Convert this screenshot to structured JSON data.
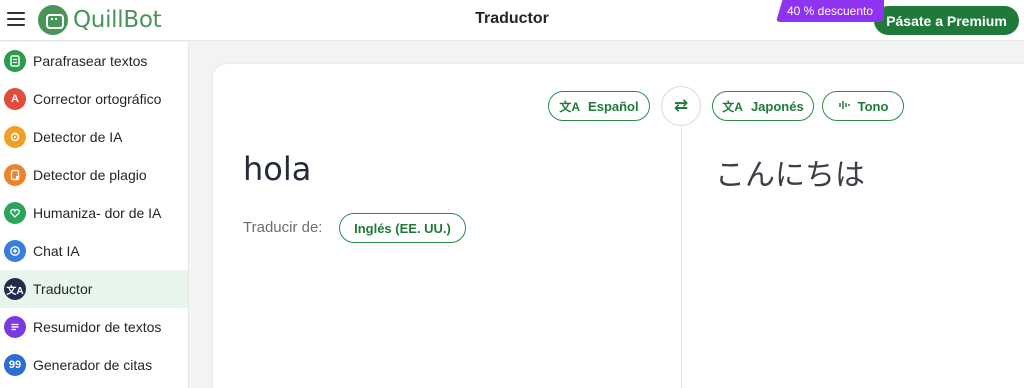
{
  "header": {
    "logo_text": "QuillBot",
    "title": "Traductor",
    "discount_badge": "40 % descuento",
    "premium_label": "Pásate a Premium"
  },
  "sidebar": {
    "items": [
      {
        "label": "Parafrasear textos",
        "icon": "paraphrase-icon",
        "color": "#2a9a4b",
        "glyph": "≡"
      },
      {
        "label": "Corrector ortográfico",
        "icon": "grammar-icon",
        "color": "#e04d3a",
        "glyph": "A"
      },
      {
        "label": "Detector de IA",
        "icon": "ai-detector-icon",
        "color": "#f0a028",
        "glyph": "◎"
      },
      {
        "label": "Detector de plagio",
        "icon": "plagiarism-icon",
        "color": "#f08228",
        "glyph": "▤"
      },
      {
        "label": "Humaniza- dor de IA",
        "icon": "humanizer-icon",
        "color": "#2aa55a",
        "glyph": "♥"
      },
      {
        "label": "Chat IA",
        "icon": "chat-icon",
        "color": "#3a7de0",
        "glyph": "+"
      },
      {
        "label": "Traductor",
        "icon": "translator-icon",
        "color": "#1f2c4c",
        "glyph": "文"
      },
      {
        "label": "Resumidor de textos",
        "icon": "summarizer-icon",
        "color": "#7a3ae0",
        "glyph": "≡"
      },
      {
        "label": "Generador de citas",
        "icon": "citation-icon",
        "color": "#2a6fd0",
        "glyph": "99"
      }
    ]
  },
  "translator": {
    "source_lang": "Español",
    "target_lang": "Japonés",
    "tone_label": "Tono",
    "source_text": "hola",
    "target_text": "こんにちは",
    "translate_from_label": "Traducir de:",
    "detected_lang": "Inglés (EE. UU.)"
  },
  "colors": {
    "brand_green": "#499557",
    "accent_green": "#1f7a3a",
    "badge_purple": "#8e33f0",
    "active_bg": "#e8f5ec"
  }
}
